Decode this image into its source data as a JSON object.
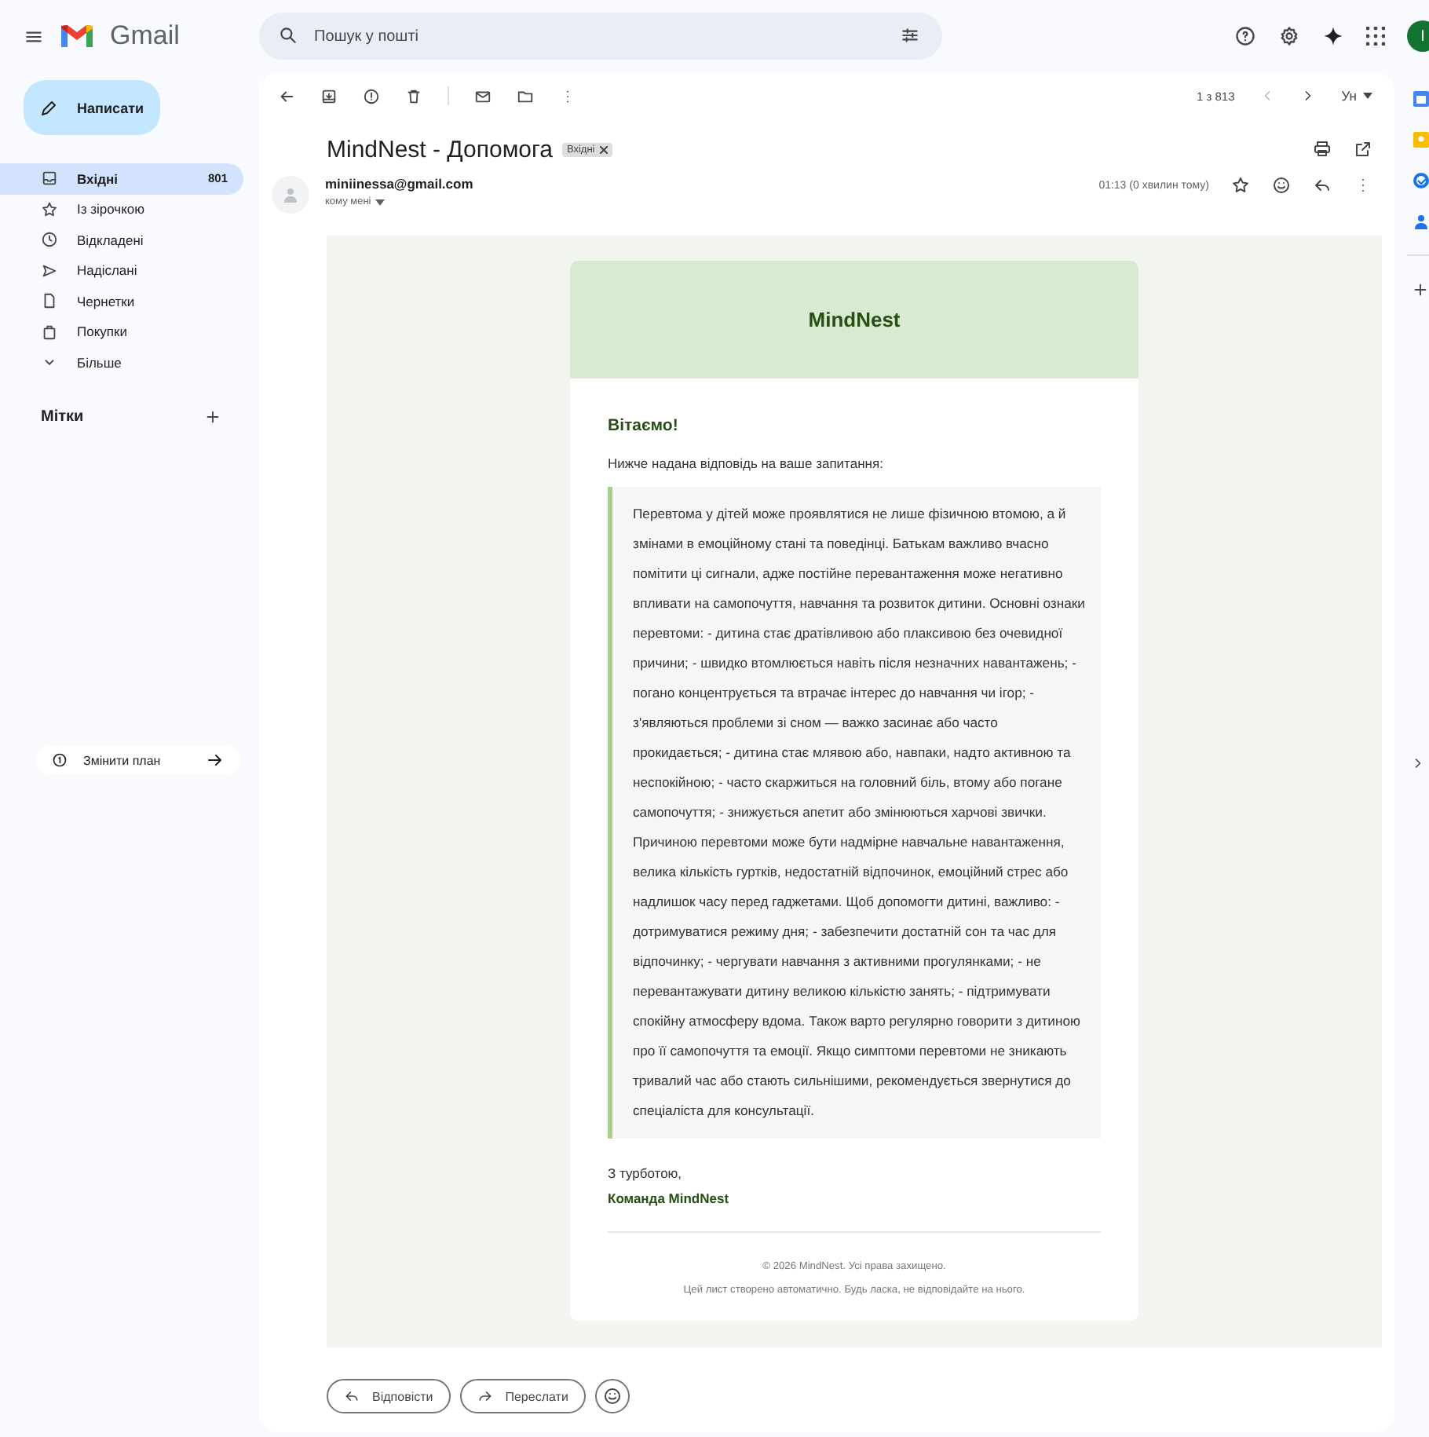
{
  "header": {
    "brand": "Gmail",
    "search": {
      "placeholder": "Пошук у пошті"
    },
    "avatar": "I"
  },
  "sidebar": {
    "compose": "Написати",
    "folders": [
      {
        "label": "Вхідні",
        "count": "801",
        "selected": true
      },
      {
        "label": "Із зірочкою",
        "selected": false
      },
      {
        "label": "Відкладені",
        "selected": false
      },
      {
        "label": "Надіслані",
        "selected": false
      },
      {
        "label": "Чернетки",
        "selected": false
      },
      {
        "label": "Покупки",
        "selected": false
      },
      {
        "label": "Більше",
        "selected": false
      }
    ],
    "labels_heading": "Мітки",
    "upgrade": "Змінити план"
  },
  "toolbar": {
    "pager": "1 з 813",
    "input_language": "Ун"
  },
  "message": {
    "subject": "MindNest - Допомога",
    "tag": "Вхідні",
    "sender": "miniinessa@gmail.com",
    "recipient": "кому мені",
    "time": "01:13 (0 хвилин тому)"
  },
  "email": {
    "brand": "MindNest",
    "greeting": "Вітаємо!",
    "intro": "Нижче надана відповідь на ваше запитання:",
    "answer": "Перевтома у дітей може проявлятися не лише фізичною втомою, а й змінами в емоційному стані та поведінці. Батькам важливо вчасно помітити ці сигнали, адже постійне перевантаження може негативно впливати на самопочуття, навчання та розвиток дитини. Основні ознаки перевтоми: - дитина стає дратівливою або плаксивою без очевидної причини; - швидко втомлюється навіть після незначних навантажень; - погано концентрується та втрачає інтерес до навчання чи ігор; - з'являються проблеми зі сном — важко засинає або часто прокидається; - дитина стає млявою або, навпаки, надто активною та неспокійною; - часто скаржиться на головний біль, втому або погане самопочуття; - знижується апетит або змінюються харчові звички. Причиною перевтоми може бути надмірне навчальне навантаження, велика кількість гуртків, недостатній відпочинок, емоційний стрес або надлишок часу перед гаджетами. Щоб допомогти дитині, важливо: - дотримуватися режиму дня; - забезпечити достатній сон та час для відпочинку; - чергувати навчання з активними прогулянками; - не перевантажувати дитину великою кількістю занять; - підтримувати спокійну атмосферу вдома. Також варто регулярно говорити з дитиною про її самопочуття та емоції. Якщо симптоми перевтоми не зникають тривалий час або стають сильнішими, рекомендується звернутися до спеціаліста для консультації.",
    "signoff": "З турботою,",
    "team": "Команда MindNest",
    "copyright": "© 2026 MindNest. Усі права захищено.",
    "notice": "Цей лист створено автоматично. Будь ласка, не відповідайте на нього."
  },
  "actions": [
    "Відповісти",
    "Переслати"
  ]
}
